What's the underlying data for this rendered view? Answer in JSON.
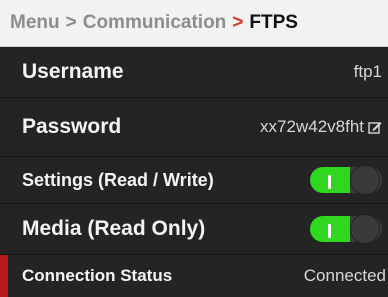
{
  "breadcrumb": {
    "items": [
      "Menu",
      "Communication"
    ],
    "separator": ">",
    "current": "FTPS"
  },
  "rows": {
    "username": {
      "label": "Username",
      "value": "ftp1"
    },
    "password": {
      "label": "Password",
      "value": "xx72w42v8fht",
      "icon": "edit-icon"
    },
    "settings": {
      "label": "Settings (Read / Write)",
      "enabled": true
    },
    "media": {
      "label": "Media (Read Only)",
      "enabled": true
    },
    "connection_status": {
      "label": "Connection Status",
      "value": "Connected"
    }
  },
  "colors": {
    "accent": "#d63a2a",
    "toggle_on": "#2fd81f",
    "status_marker": "#b71c1c",
    "background": "#1f1f1f"
  }
}
